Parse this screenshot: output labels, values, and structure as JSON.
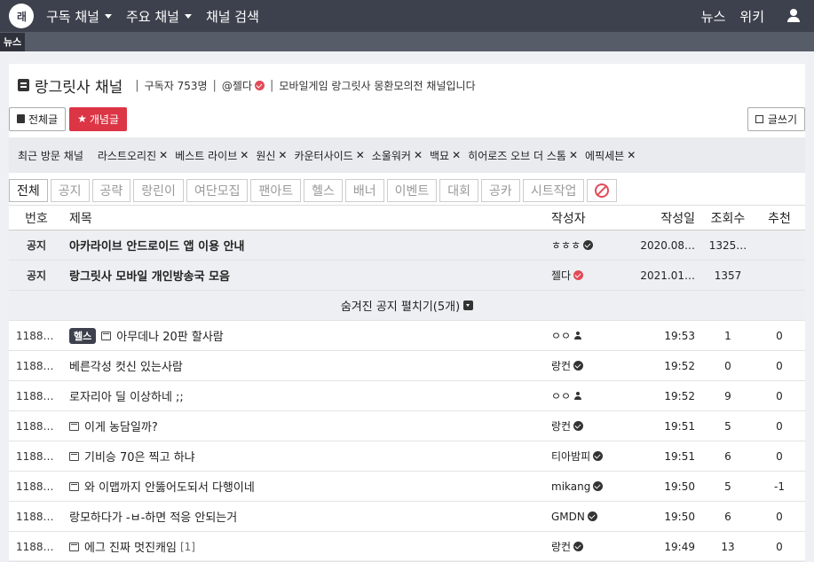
{
  "topnav": {
    "logo_text": "래",
    "items": [
      "구독 채널",
      "주요 채널",
      "채널 검색"
    ],
    "right_items": [
      "뉴스",
      "위키"
    ]
  },
  "subnav": {
    "item": "뉴스"
  },
  "channel": {
    "title": "랑그릿사 채널",
    "subscribers": "구독자 753명",
    "owner": "@젤다",
    "description": "모바일게임 랑그릿사 몽환모의전 채널입니다"
  },
  "toolbar": {
    "all_label": "전체글",
    "best_label": "개념글",
    "write_label": "글쓰기"
  },
  "recent": {
    "label": "최근 방문 채널",
    "items": [
      "라스트오리진",
      "베스트 라이브",
      "원신",
      "카운터사이드",
      "소울워커",
      "백묘",
      "히어로즈 오브 더 스톰",
      "에픽세븐"
    ]
  },
  "categories": [
    "전체",
    "공지",
    "공략",
    "랑린이",
    "여단모집",
    "팬아트",
    "헬스",
    "배너",
    "이벤트",
    "대회",
    "공카",
    "시트작업"
  ],
  "table": {
    "headers": {
      "no": "번호",
      "title": "제목",
      "author": "작성자",
      "date": "작성일",
      "views": "조회수",
      "rec": "추천"
    },
    "notices": [
      {
        "no": "공지",
        "title": "아카라이브 안드로이드 앱 이용 안내",
        "author": "ㅎㅎㅎ",
        "date": "2020.08…",
        "views": "1325…",
        "rec": ""
      },
      {
        "no": "공지",
        "title": "랑그릿사 모바일 개인방송국 모음",
        "author": "젤다",
        "date": "2021.01…",
        "views": "1357",
        "rec": ""
      }
    ],
    "hidden_notice": "숨겨진 공지 펼치기(5개)",
    "rows": [
      {
        "no": "1188…",
        "badge": "헬스",
        "img": true,
        "title": "아무데나 20판 할사람",
        "comments": "",
        "author": "ㅇㅇ",
        "author_type": "anon",
        "date": "19:53",
        "views": "1",
        "rec": "0"
      },
      {
        "no": "1188…",
        "badge": "",
        "img": false,
        "title": "베른각성 컷신 있는사람",
        "comments": "",
        "author": "랑컨",
        "author_type": "verified",
        "date": "19:52",
        "views": "0",
        "rec": "0"
      },
      {
        "no": "1188…",
        "badge": "",
        "img": false,
        "title": "로자리아 딜 이상하네 ;;",
        "comments": "",
        "author": "ㅇㅇ",
        "author_type": "anon",
        "date": "19:52",
        "views": "9",
        "rec": "0"
      },
      {
        "no": "1188…",
        "badge": "",
        "img": true,
        "title": "이게 농담일까?",
        "comments": "",
        "author": "랑컨",
        "author_type": "verified",
        "date": "19:51",
        "views": "5",
        "rec": "0"
      },
      {
        "no": "1188…",
        "badge": "",
        "img": true,
        "title": "기비승 70은 찍고 하냐",
        "comments": "",
        "author": "티아밤피",
        "author_type": "verified",
        "date": "19:51",
        "views": "6",
        "rec": "0"
      },
      {
        "no": "1188…",
        "badge": "",
        "img": true,
        "title": "와 이맵까지 안뚫어도되서 다행이네",
        "comments": "",
        "author": "mikang",
        "author_type": "verified",
        "date": "19:50",
        "views": "5",
        "rec": "-1"
      },
      {
        "no": "1188…",
        "badge": "",
        "img": false,
        "title": "랑모하다가 -ㅂ-하면 적응 안되는거",
        "comments": "",
        "author": "GMDN",
        "author_type": "verified",
        "date": "19:50",
        "views": "6",
        "rec": "0"
      },
      {
        "no": "1188…",
        "badge": "",
        "img": true,
        "title": "에그 진짜 멋진캐임",
        "comments": "[1]",
        "author": "랑컨",
        "author_type": "verified",
        "date": "19:49",
        "views": "13",
        "rec": "0"
      }
    ]
  }
}
